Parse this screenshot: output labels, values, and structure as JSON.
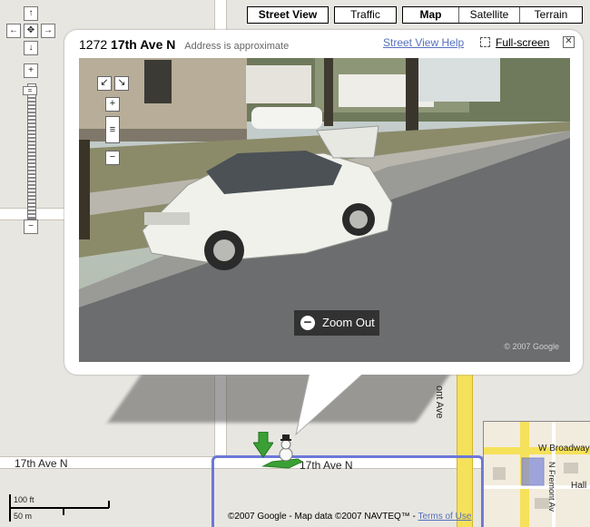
{
  "map_types": {
    "street_view": "Street View",
    "traffic": "Traffic",
    "map": "Map",
    "satellite": "Satellite",
    "terrain": "Terrain"
  },
  "navigation": {
    "pan_up": "↑",
    "pan_left": "←",
    "pan_right": "→",
    "pan_down": "↓",
    "center": "✥",
    "zoom_in": "+",
    "zoom_out": "−"
  },
  "popup": {
    "address_number": "1272",
    "address_street": "17th Ave N",
    "address_note": "Address is approximate",
    "street_view_help": "Street View Help",
    "full_screen": "Full-screen",
    "close": "✕",
    "zoom_out_label": "Zoom Out",
    "photo_copyright": "© 2007 Google",
    "sv_zoom_in": "+",
    "sv_zoom_out": "−"
  },
  "map_labels": {
    "street_left": "17th Ave N",
    "street_right": "17th Ave N",
    "vertical_street": "ont Ave",
    "inset_street": "W Broadway",
    "inset_vertical": "N Fremont Av",
    "inset_hall": "Hall"
  },
  "scale": {
    "imperial": "100 ft",
    "metric": "50 m"
  },
  "copyright": {
    "text": "©2007 Google - Map data ©2007 NAVTEQ™ - ",
    "terms": "Terms of Use"
  },
  "colors": {
    "route": "#6b78d8",
    "major_road": "#f6e15a",
    "link": "#5570bd"
  }
}
